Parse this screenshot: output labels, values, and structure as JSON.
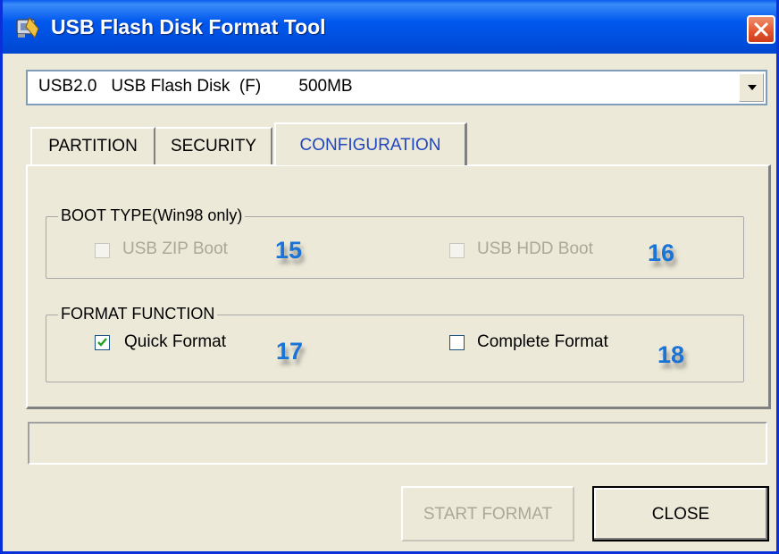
{
  "window": {
    "title": "USB Flash Disk Format Tool",
    "app_icon": "usb-tool-icon",
    "close_icon": "close-icon"
  },
  "device_select": {
    "value": "USB2.0   USB Flash Disk  (F)        500MB",
    "arrow_icon": "chevron-down-icon"
  },
  "tabs": [
    {
      "label": "PARTITION",
      "active": false
    },
    {
      "label": "SECURITY",
      "active": false
    },
    {
      "label": "CONFIGURATION",
      "active": true
    }
  ],
  "boot_type": {
    "label": "BOOT TYPE(Win98 only)",
    "options": [
      {
        "label": "USB ZIP Boot",
        "checked": false,
        "enabled": false,
        "marker": "15"
      },
      {
        "label": "USB HDD Boot",
        "checked": false,
        "enabled": false,
        "marker": "16"
      }
    ]
  },
  "format_function": {
    "label": "FORMAT FUNCTION",
    "options": [
      {
        "label": "Quick Format",
        "checked": true,
        "enabled": true,
        "marker": "17"
      },
      {
        "label": "Complete Format",
        "checked": false,
        "enabled": true,
        "marker": "18"
      }
    ]
  },
  "status": "",
  "buttons": {
    "start_format": "START FORMAT",
    "close": "CLOSE"
  },
  "colors": {
    "titlebar": "#0058ee",
    "active_tab_text": "#2046c0",
    "marker": "#1a73d6",
    "close_button": "#e2542e"
  }
}
